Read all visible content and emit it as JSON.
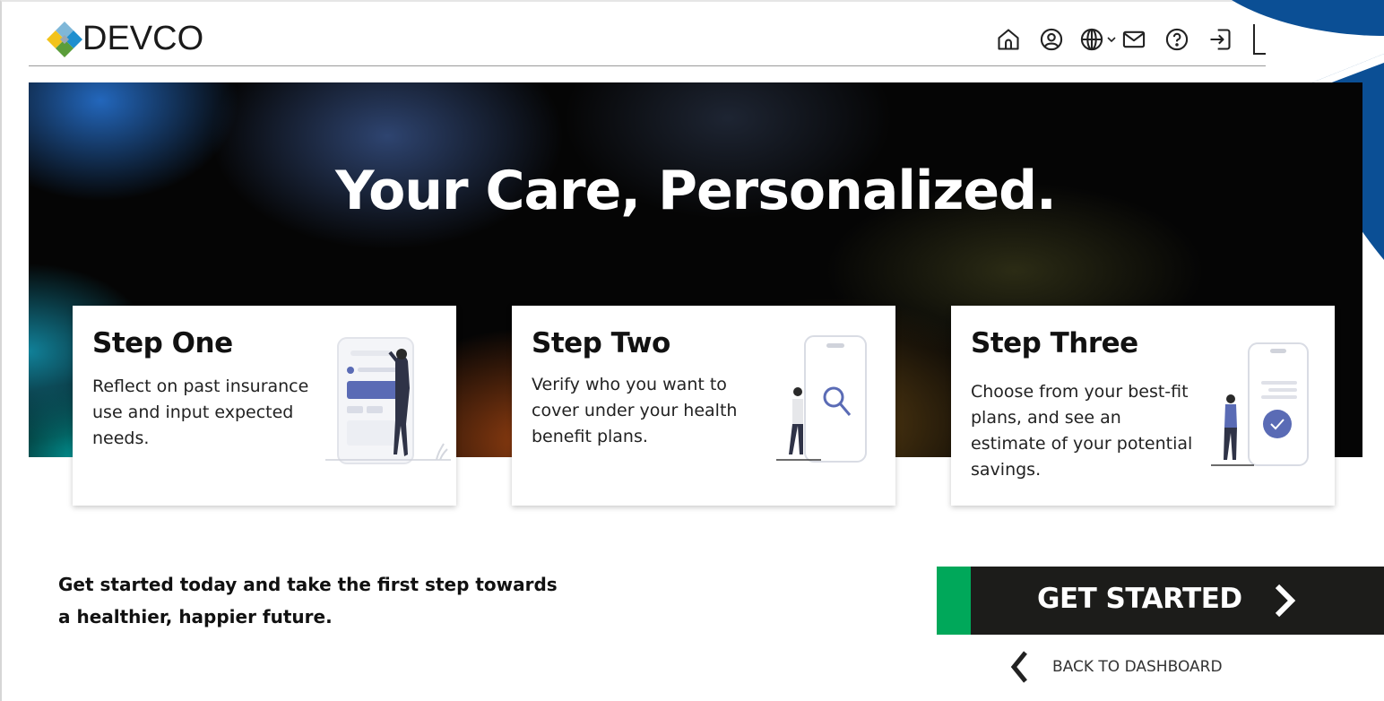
{
  "brand": {
    "name": "DEVCO"
  },
  "nav": {
    "icons": [
      "home-icon",
      "account-icon",
      "globe-icon",
      "chevron-down-icon",
      "mail-icon",
      "help-icon",
      "logout-icon"
    ]
  },
  "hero": {
    "title": "Your Care, Personalized."
  },
  "steps": [
    {
      "title": "Step One",
      "text": "Reflect on past insurance use and input expected needs."
    },
    {
      "title": "Step Two",
      "text": "Verify who you want to cover under your health benefit plans."
    },
    {
      "title": "Step Three",
      "text": "Choose from your best-fit plans, and see an estimate of your potential savings."
    }
  ],
  "cta": {
    "text": "Get started today and take the first step towards a healthier, happier future.",
    "button_label": "GET STARTED",
    "back_label": "BACK TO DASHBOARD"
  },
  "colors": {
    "accent_green": "#00a85a",
    "button_dark": "#1c1c1a",
    "deco_blue": "#0b4f95",
    "illustration_purple": "#5a6bb5"
  }
}
